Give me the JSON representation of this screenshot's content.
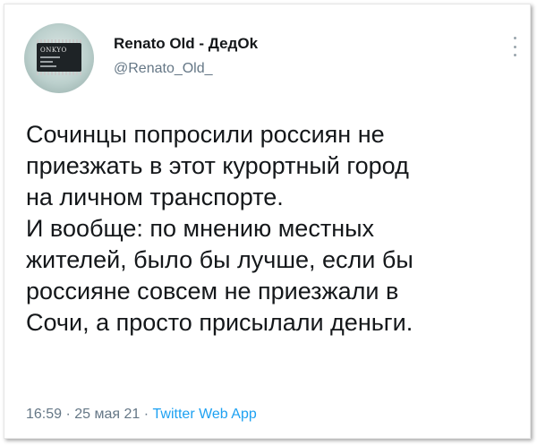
{
  "author": {
    "name": "Renato Old - ДедOk",
    "handle": "@Renato_Old_",
    "avatar_chip_text": "ONKYO"
  },
  "tweet": {
    "lines": [
      "Сочинцы попросили россиян не",
      "приезжать в этот курортный город",
      "на личном транспорте.",
      "И вообще: по мнению местных",
      "жителей, было бы лучше, если бы",
      "россияне совсем не приезжали в",
      "Сочи, а просто присылали деньги."
    ]
  },
  "meta": {
    "time": "16:59",
    "separator": " · ",
    "date": "25 мая 21",
    "source": "Twitter Web App"
  },
  "icons": {
    "more": "more-vertical-icon"
  },
  "colors": {
    "text": "#14171a",
    "secondary": "#657786",
    "link": "#1da1f2"
  }
}
